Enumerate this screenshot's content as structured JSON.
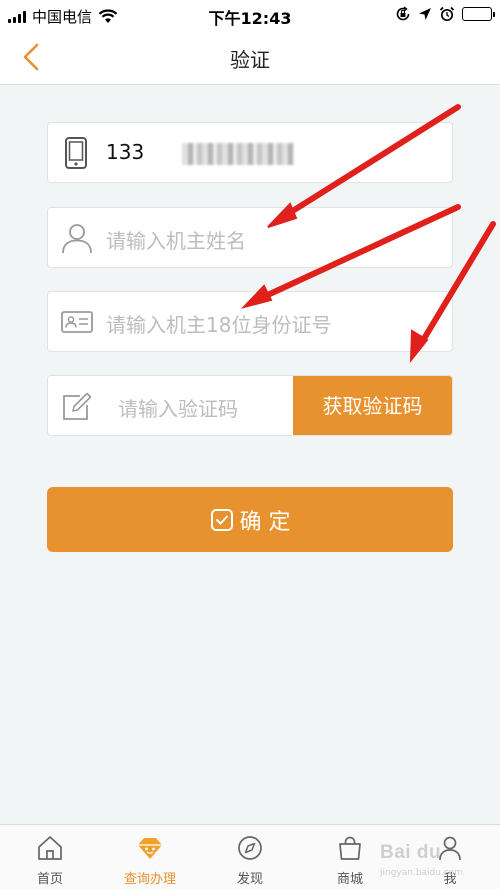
{
  "status_bar": {
    "carrier": "中国电信",
    "time": "下午12:43",
    "icons": [
      "signal-icon",
      "wifi-icon",
      "orientation-lock-icon",
      "location-icon",
      "alarm-icon",
      "battery-icon"
    ]
  },
  "nav": {
    "title": "验证",
    "back_icon": "chevron-left-icon"
  },
  "form": {
    "phone": {
      "value": "133",
      "icon": "phone-icon"
    },
    "name": {
      "placeholder": "请输入机主姓名",
      "icon": "user-icon"
    },
    "id_number": {
      "placeholder": "请输入机主18位身份证号",
      "icon": "id-card-icon"
    },
    "code": {
      "placeholder": "请输入验证码",
      "icon": "edit-icon",
      "button": "获取验证码"
    }
  },
  "confirm_button": {
    "label": "确 定",
    "icon": "check-square-icon"
  },
  "tabs": [
    {
      "label": "首页",
      "icon": "home-icon",
      "active": false
    },
    {
      "label": "查询办理",
      "icon": "diamond-icon",
      "active": true
    },
    {
      "label": "发现",
      "icon": "compass-icon",
      "active": false
    },
    {
      "label": "商城",
      "icon": "shopping-bag-icon",
      "active": false
    },
    {
      "label": "我",
      "icon": "person-icon",
      "active": false
    }
  ],
  "watermark": {
    "text": "Bai du",
    "sub": "jingyan.baidu.com"
  },
  "colors": {
    "accent": "#e8922f",
    "annotation_arrow": "#e0201b",
    "background": "#f2f5f5"
  }
}
